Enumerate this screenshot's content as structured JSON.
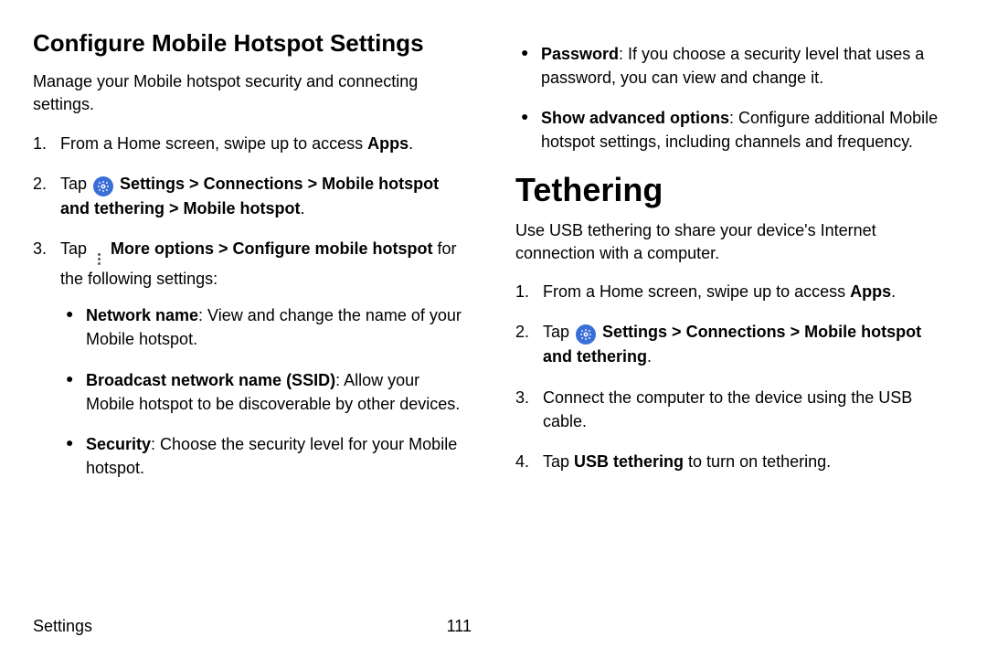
{
  "left": {
    "title": "Configure Mobile Hotspot Settings",
    "intro": "Manage your Mobile hotspot security and connecting settings.",
    "step1_a": "From a Home screen, swipe up to access ",
    "step1_b": "Apps",
    "step1_c": ".",
    "step2_a": "Tap ",
    "step2_b": "Settings > Connections > Mobile hotspot and tethering > Mobile hotspot",
    "step2_c": ".",
    "step3_a": "Tap ",
    "step3_b": "More options > Configure mobile hotspot",
    "step3_c": " for the following settings:",
    "sub1_b": "Network name",
    "sub1_t": ": View and change the name of your Mobile hotspot.",
    "sub2_b": "Broadcast network name (SSID)",
    "sub2_t": ": Allow your Mobile hotspot to be discoverable by other devices.",
    "sub3_b": "Security",
    "sub3_t": ": Choose the security level for your Mobile hotspot."
  },
  "right": {
    "sub4_b": "Password",
    "sub4_t": ": If you choose a security level that uses a password, you can view and change it.",
    "sub5_b": "Show advanced options",
    "sub5_t": ": Configure additional Mobile hotspot settings, including channels and frequency.",
    "title": "Tethering",
    "intro": "Use USB tethering to share your device's Internet connection with a computer.",
    "step1_a": "From a Home screen, swipe up to access ",
    "step1_b": "Apps",
    "step1_c": ".",
    "step2_a": "Tap ",
    "step2_b": "Settings > Connections > Mobile hotspot and tethering",
    "step2_c": ".",
    "step3": "Connect the computer to the device using the USB cable.",
    "step4_a": "Tap ",
    "step4_b": "USB tethering",
    "step4_c": " to turn on tethering."
  },
  "footer": {
    "section": "Settings",
    "page": "111"
  }
}
